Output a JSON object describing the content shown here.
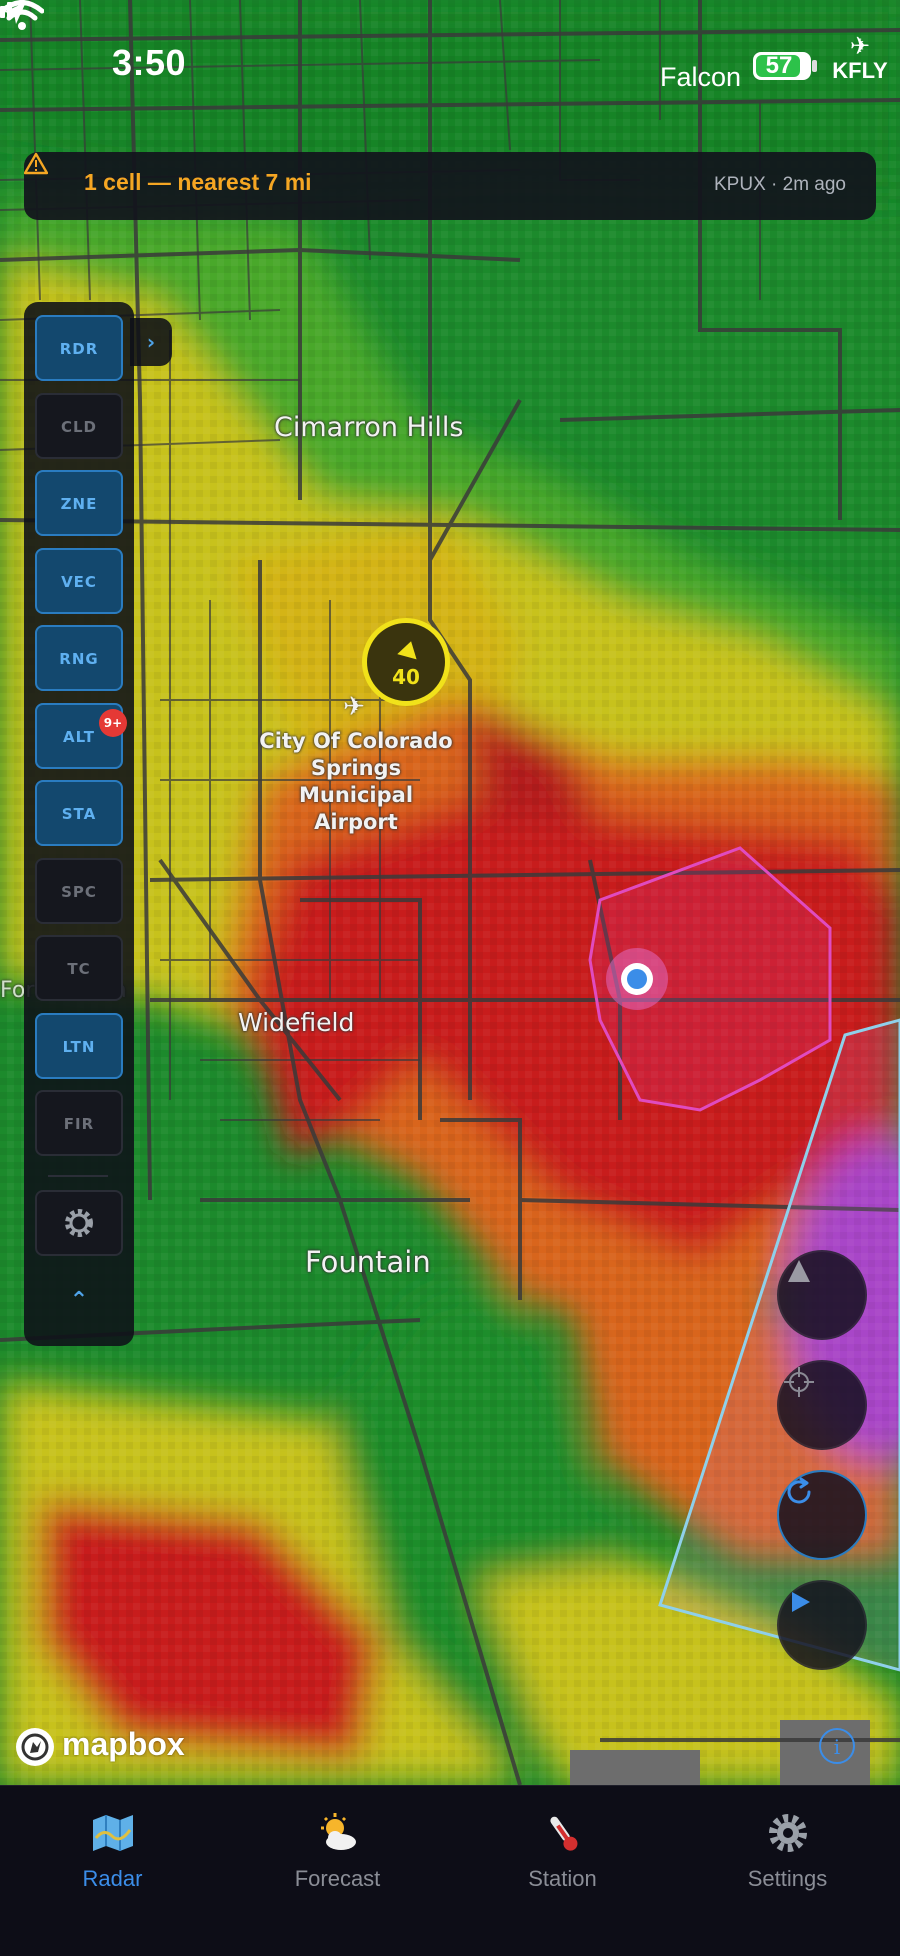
{
  "status_bar": {
    "time": "3:50",
    "carrier": "Falcon",
    "battery": "57",
    "station_code": "KFLY"
  },
  "alert": {
    "message": "1 cell — nearest 7 mi",
    "meta": "KPUX · 2m ago"
  },
  "layers": [
    {
      "label": "RDR",
      "active": true
    },
    {
      "label": "CLD",
      "active": false
    },
    {
      "label": "ZNE",
      "active": true
    },
    {
      "label": "VEC",
      "active": true
    },
    {
      "label": "RNG",
      "active": true
    },
    {
      "label": "ALT",
      "active": true,
      "badge": "9+"
    },
    {
      "label": "STA",
      "active": true
    },
    {
      "label": "SPC",
      "active": false
    },
    {
      "label": "TC",
      "active": false
    },
    {
      "label": "LTN",
      "active": true
    },
    {
      "label": "FIR",
      "active": false
    }
  ],
  "map_labels": {
    "cimarron": "Cimarron Hills",
    "airport_line1": "City Of Colorado",
    "airport_line2": "Springs Municipal",
    "airport_line3": "Airport",
    "widefield": "Widefield",
    "fountain": "Fountain",
    "fort_carson": "Fort Carson"
  },
  "storm_cell": {
    "value": "40"
  },
  "attribution": {
    "logo_text": "mapbox",
    "info": "i"
  },
  "tabs": [
    {
      "label": "Radar",
      "icon": "map-icon",
      "active": true
    },
    {
      "label": "Forecast",
      "icon": "sun-cloud-icon",
      "active": false
    },
    {
      "label": "Station",
      "icon": "thermometer-icon",
      "active": false
    },
    {
      "label": "Settings",
      "icon": "gear-icon",
      "active": false
    }
  ],
  "colors": {
    "accent": "#3b8de8",
    "alert": "#f5a623",
    "cell": "#f1e21a",
    "radar_green": "#1e8a2a",
    "radar_yellow": "#c9c31a",
    "radar_red": "#c81e1e"
  }
}
